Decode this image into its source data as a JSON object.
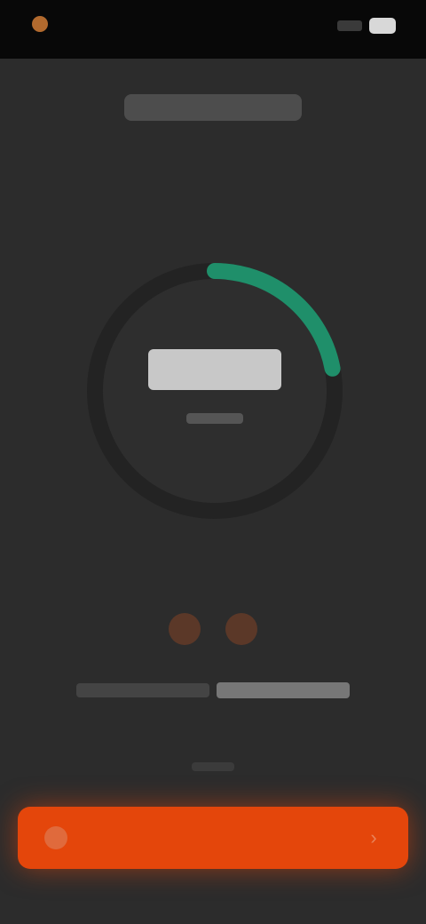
{
  "status_bar": {
    "app_label": "",
    "icons": [
      "app-icon",
      "signal-icon",
      "battery-icon"
    ]
  },
  "header": {
    "overline": "",
    "title": ""
  },
  "timer": {
    "value": "",
    "caption": "",
    "progress": 0.22,
    "ring_color": "#1f8f6a",
    "track_color": "#232323"
  },
  "sessions": {
    "count": 2,
    "dot_color": "#5b3828"
  },
  "info": {
    "prefix": "",
    "link": ""
  },
  "small_caption": "",
  "primary_button": {
    "label": "",
    "icon": "play-icon",
    "chevron_icon": "chevron-right-icon",
    "color": "#e4460b"
  }
}
